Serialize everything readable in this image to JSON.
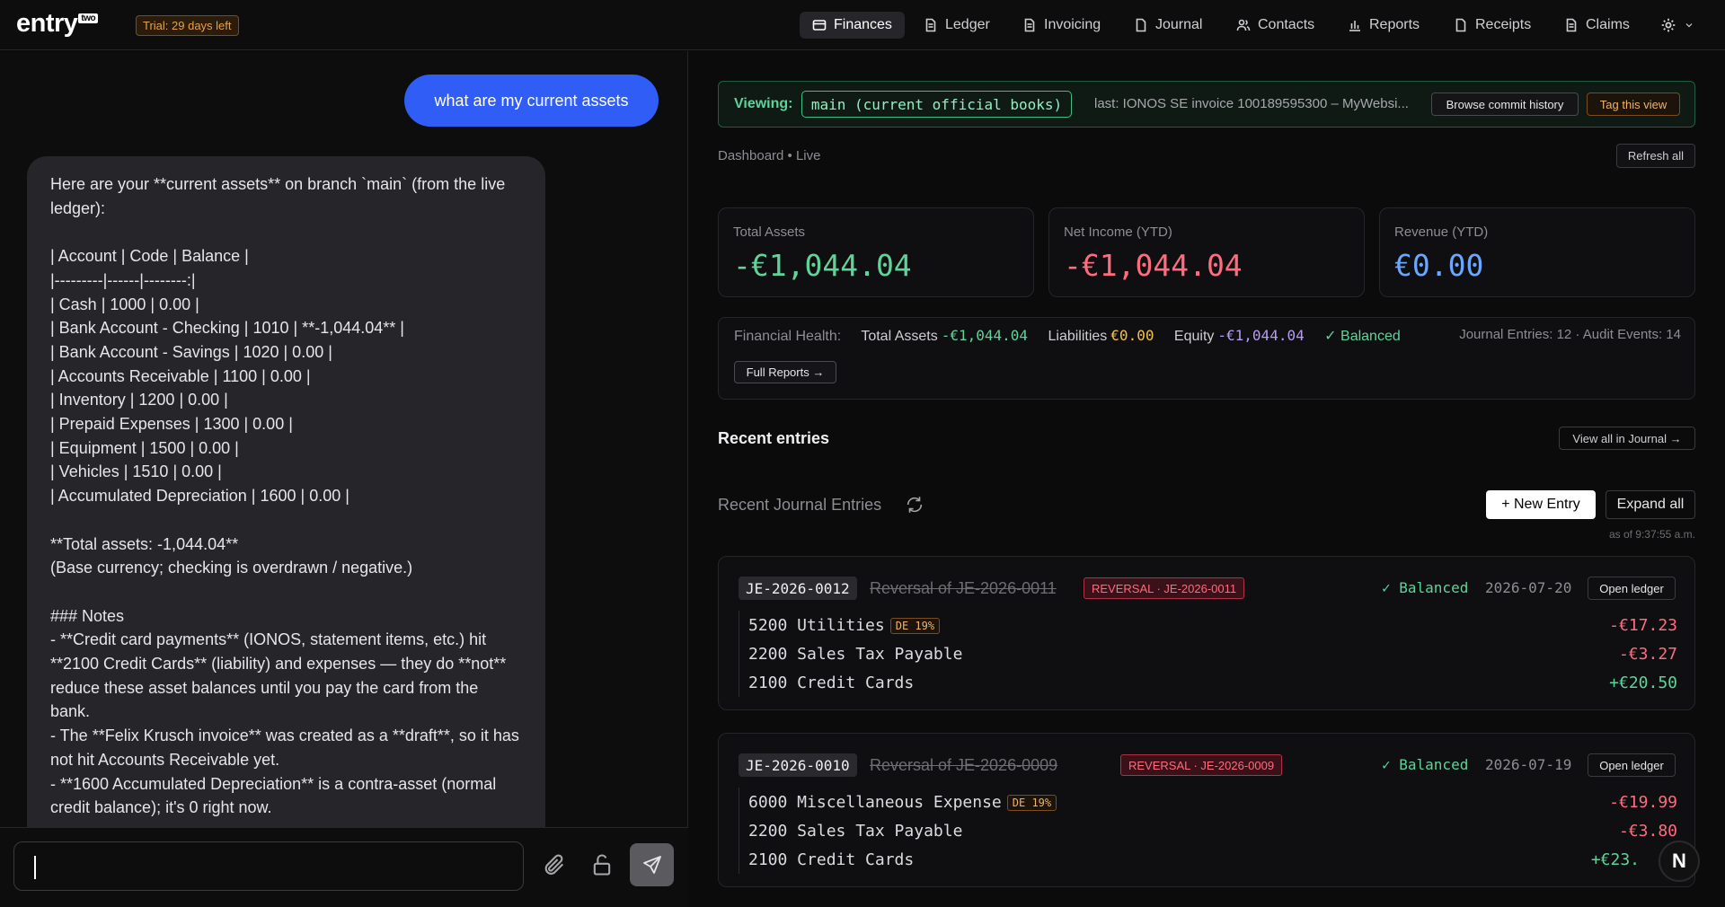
{
  "app": {
    "logo": "entry",
    "logo_sup": "two",
    "trial": "Trial: 29 days left"
  },
  "nav": [
    {
      "label": "Finances",
      "icon": "card-icon"
    },
    {
      "label": "Ledger",
      "icon": "doc-icon"
    },
    {
      "label": "Invoicing",
      "icon": "doc-icon"
    },
    {
      "label": "Journal",
      "icon": "page-icon"
    },
    {
      "label": "Contacts",
      "icon": "people-icon"
    },
    {
      "label": "Reports",
      "icon": "bar-chart-icon"
    },
    {
      "label": "Receipts",
      "icon": "page-icon"
    },
    {
      "label": "Claims",
      "icon": "doc-icon"
    }
  ],
  "chat": {
    "user_message": "what are my current assets",
    "assistant_message": "Here are your **current assets** on branch `main` (from the live ledger):\n\n| Account | Code | Balance |\n|---------|------|--------:|\n| Cash | 1000 | 0.00 |\n| Bank Account - Checking | 1010 | **-1,044.04** |\n| Bank Account - Savings | 1020 | 0.00 |\n| Accounts Receivable | 1100 | 0.00 |\n| Inventory | 1200 | 0.00 |\n| Prepaid Expenses | 1300 | 0.00 |\n| Equipment | 1500 | 0.00 |\n| Vehicles | 1510 | 0.00 |\n| Accumulated Depreciation | 1600 | 0.00 |\n\n**Total assets: -1,044.04**\n(Base currency; checking is overdrawn / negative.)\n\n### Notes\n- **Credit card payments** (IONOS, statement items, etc.) hit **2100 Credit Cards** (liability) and expenses — they do **not** reduce these asset balances until you pay the card from the bank.\n- The **Felix Krusch invoice** was created as a **draft**, so it has not hit Accounts Receivable yet.\n- **1600 Accumulated Depreciation** is a contra-asset (normal credit balance); it's 0 right now.",
    "input_value": ""
  },
  "viewing": {
    "label": "Viewing:",
    "branch": "main (current official books)",
    "last": "last: IONOS SE invoice 100189595300 – MyWebsi...",
    "browse": "Browse commit history",
    "tag": "Tag this view"
  },
  "dashboard": {
    "label": "Dashboard • Live",
    "refresh": "Refresh all",
    "cards": [
      {
        "label": "Total Assets",
        "value": "-€1,044.04",
        "color": "#5fd39a"
      },
      {
        "label": "Net Income (YTD)",
        "value": "-€1,044.04",
        "color": "#ff6b7f"
      },
      {
        "label": "Revenue (YTD)",
        "value": "€0.00",
        "color": "#6aa7ff"
      }
    ],
    "health": {
      "label": "Financial Health:",
      "total_assets_label": "Total Assets",
      "total_assets_value": "-€1,044.04",
      "liabilities_label": "Liabilities",
      "liabilities_value": "€0.00",
      "equity_label": "Equity",
      "equity_value": "-€1,044.04",
      "balanced": "✓ Balanced",
      "right": "Journal Entries: 12 · Audit Events: 14",
      "full_reports": "Full Reports →"
    }
  },
  "recent": {
    "title": "Recent entries",
    "view_all": "View all in Journal →",
    "journal_title": "Recent Journal Entries",
    "new_entry": "+ New Entry",
    "expand_all": "Expand all",
    "as_of": "as of 9:37:55 a.m."
  },
  "entries": [
    {
      "id": "JE-2026-0012",
      "desc": "Reversal of JE-2026-0011",
      "badge": "REVERSAL · JE-2026-0011",
      "balanced": "✓ Balanced",
      "date": "2026-07-20",
      "open": "Open ledger",
      "lines": [
        {
          "account": "5200 Utilities",
          "tax": "DE 19%",
          "amount": "-€17.23",
          "sign": "neg"
        },
        {
          "account": "2200 Sales Tax Payable",
          "tax": "",
          "amount": "-€3.27",
          "sign": "neg"
        },
        {
          "account": "2100 Credit Cards",
          "tax": "",
          "amount": "+€20.50",
          "sign": "pos"
        }
      ]
    },
    {
      "id": "JE-2026-0010",
      "desc": "Reversal of JE-2026-0009",
      "badge": "REVERSAL · JE-2026-0009",
      "balanced": "✓ Balanced",
      "date": "2026-07-19",
      "open": "Open ledger",
      "lines": [
        {
          "account": "6000 Miscellaneous Expense",
          "tax": "DE 19%",
          "amount": "-€19.99",
          "sign": "neg"
        },
        {
          "account": "2200 Sales Tax Payable",
          "tax": "",
          "amount": "-€3.80",
          "sign": "neg"
        },
        {
          "account": "2100 Credit Cards",
          "tax": "",
          "amount": "+€23.",
          "sign": "pos"
        }
      ]
    }
  ],
  "avatar": "N"
}
